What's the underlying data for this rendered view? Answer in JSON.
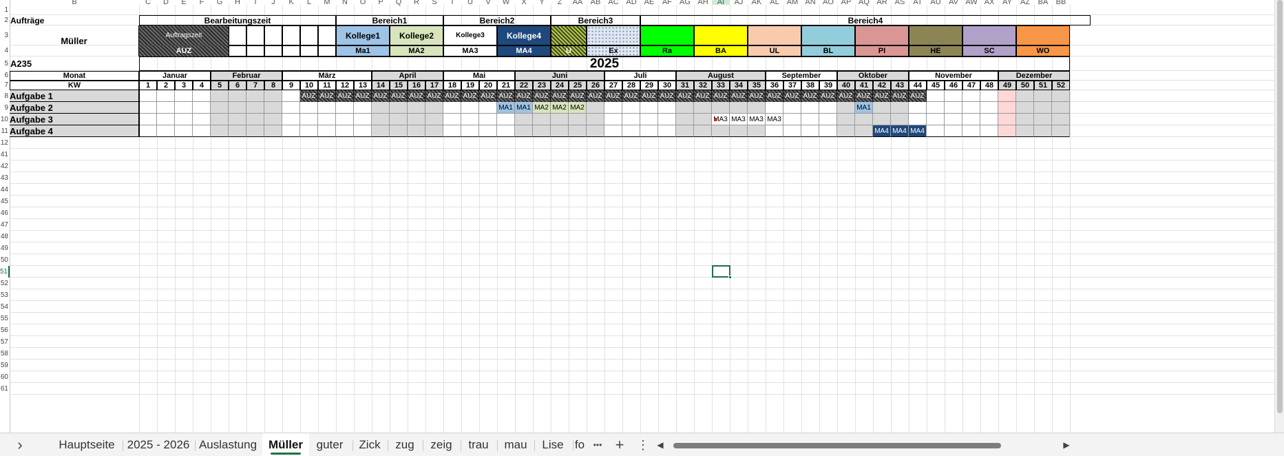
{
  "sheet": {
    "column_letters": [
      "B",
      "C",
      "D",
      "E",
      "F",
      "G",
      "H",
      "I",
      "J",
      "K",
      "L",
      "M",
      "N",
      "O",
      "P",
      "Q",
      "R",
      "S",
      "T",
      "U",
      "V",
      "W",
      "X",
      "Y",
      "Z",
      "AA",
      "AB",
      "AC",
      "AD",
      "AE",
      "AF",
      "AG",
      "AH",
      "AI",
      "AJ",
      "AK",
      "AL",
      "AM",
      "AN",
      "AO",
      "AP",
      "AQ",
      "AR",
      "AS",
      "AT",
      "AU",
      "AV",
      "AW",
      "AX",
      "AY",
      "AZ",
      "BA",
      "BB"
    ],
    "row_numbers": [
      "1",
      "2",
      "3",
      "4",
      "5",
      "6",
      "7",
      "8",
      "9",
      "10",
      "11",
      "12",
      "41",
      "42",
      "43",
      "44",
      "45",
      "46",
      "47",
      "48",
      "49",
      "50",
      "51",
      "52",
      "53",
      "54",
      "55",
      "56",
      "57",
      "58",
      "59",
      "60",
      "61"
    ],
    "selected_row": "51",
    "selected_column": "AI",
    "row2": {
      "auftraege": "Aufträge",
      "bearbeitungszeit": "Bearbeitungszeit",
      "bereich1": "Bereich1",
      "bereich2": "Bereich2",
      "bereich3": "Bereich3",
      "bereich4": "Bereich4"
    },
    "name": "Müller",
    "order": "A235",
    "year": "2025",
    "auftragszeit": "Auftragszeit",
    "auz": "AUZ",
    "kollegen": [
      "Kollege1",
      "Kollege2",
      "Kollege3",
      "Kollege4"
    ],
    "ma_codes": [
      "Ma1",
      "MA2",
      "MA3",
      "MA4"
    ],
    "bereich3_codes": [
      "U",
      "Ex"
    ],
    "bereich4_codes": [
      "Ra",
      "BA",
      "UL",
      "BL",
      "PI",
      "HE",
      "SC",
      "WO"
    ],
    "colors": {
      "kollege1": "#9dc3e6",
      "kollege2": "#d8e4bc",
      "kollege3": "#ffffff",
      "kollege4": "#1f497d",
      "ra": "#00ff00",
      "ba": "#ffff00",
      "ul": "#f8cbad",
      "bl": "#92cddc",
      "pi": "#da9694",
      "he": "#8b8556",
      "sc": "#b1a0c7",
      "wo": "#f79646",
      "highlight": "#ffd7d7",
      "grey": "#d9d9d9",
      "sheet_active": "#1e7145"
    },
    "monat_label": "Monat",
    "kw_label": "KW",
    "months": [
      "Januar",
      "Februar",
      "März",
      "April",
      "Mai",
      "Juni",
      "Juli",
      "August",
      "September",
      "Oktober",
      "November",
      "Dezember"
    ],
    "weeks": [
      "1",
      "2",
      "3",
      "4",
      "5",
      "6",
      "7",
      "8",
      "9",
      "10",
      "11",
      "12",
      "13",
      "14",
      "15",
      "16",
      "17",
      "18",
      "19",
      "20",
      "21",
      "22",
      "23",
      "24",
      "25",
      "26",
      "27",
      "28",
      "29",
      "30",
      "31",
      "32",
      "33",
      "34",
      "35",
      "36",
      "37",
      "38",
      "39",
      "40",
      "41",
      "42",
      "43",
      "44",
      "45",
      "46",
      "47",
      "48",
      "49",
      "50",
      "51",
      "52"
    ],
    "tasks": [
      "Aufgabe 1",
      "Aufgabe 2",
      "Aufgabe 3",
      "Aufgabe 4"
    ],
    "task1": [
      "AUZ",
      "AUZ",
      "AUZ",
      "AUZ",
      "AUZ",
      "AUZ",
      "AUZ",
      "AUZ",
      "AUZ",
      "AUZ",
      "AUZ",
      "AUZ",
      "AUZ",
      "AUZ",
      "AUZ",
      "AUZ",
      "AUZ",
      "AUZ",
      "AUZ",
      "AUZ",
      "AUZ",
      "AUZ",
      "AUZ",
      "AUZ",
      "AUZ",
      "AUZ",
      "AUZ",
      "AUZ",
      "AUZ",
      "AUZ",
      "AUZ",
      "AUZ",
      "AUZ",
      "AUZ",
      "AUZ"
    ],
    "task2": [
      "MA1",
      "MA1",
      "MA2",
      "MA2",
      "MA2",
      "MA1"
    ],
    "task3": [
      "MA3",
      "MA3",
      "MA3",
      "MA3"
    ],
    "task4": [
      "MA4",
      "MA4",
      "MA4"
    ]
  },
  "tabs": {
    "items": [
      "Hauptseite",
      "2025 - 2026",
      "Auslastung",
      "Müller",
      "guter",
      "Zick",
      "zug",
      "zeig",
      "trau",
      "mau",
      "Lise",
      "fo"
    ],
    "active": "Müller",
    "more": "•••",
    "add": "+",
    "menu": "⋮",
    "nav": "›",
    "scroll_left": "◀",
    "scroll_right": "▶"
  }
}
